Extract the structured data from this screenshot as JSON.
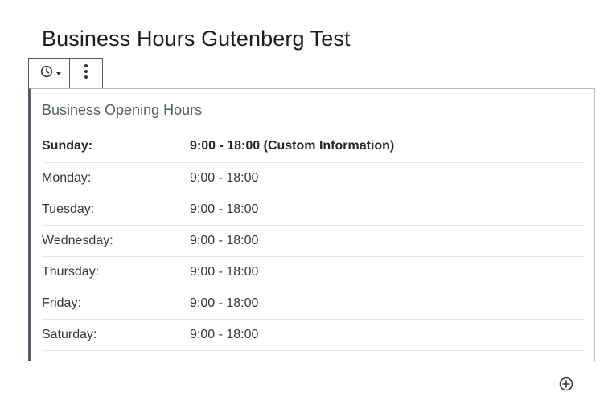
{
  "post": {
    "title": "Business Hours Gutenberg Test"
  },
  "toolbar": {
    "block_icon": "clock-icon",
    "more_icon": "more-vertical-icon"
  },
  "block": {
    "title": "Business Opening Hours",
    "rows": [
      {
        "day": "Sunday:",
        "hours": "9:00 - 18:00 (Custom Information)",
        "highlighted": true
      },
      {
        "day": "Monday:",
        "hours": "9:00 - 18:00",
        "highlighted": false
      },
      {
        "day": "Tuesday:",
        "hours": "9:00 - 18:00",
        "highlighted": false
      },
      {
        "day": "Wednesday:",
        "hours": "9:00 - 18:00",
        "highlighted": false
      },
      {
        "day": "Thursday:",
        "hours": "9:00 - 18:00",
        "highlighted": false
      },
      {
        "day": "Friday:",
        "hours": "9:00 - 18:00",
        "highlighted": false
      },
      {
        "day": "Saturday:",
        "hours": "9:00 - 18:00",
        "highlighted": false
      }
    ]
  },
  "inserter": {
    "icon": "plus-circle-icon"
  },
  "colors": {
    "text": "#32373c",
    "title": "#191e23",
    "block_border": "#555d66",
    "row_divider": "#e2e4e7"
  }
}
